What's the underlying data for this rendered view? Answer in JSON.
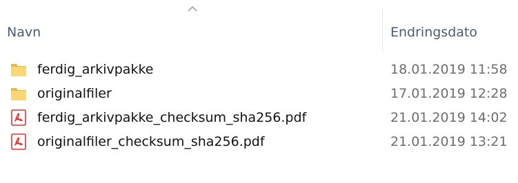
{
  "header": {
    "name_label": "Navn",
    "date_label": "Endringsdato",
    "sort_icon": "chevron-up-icon"
  },
  "files": [
    {
      "name": "ferdig_arkivpakke",
      "modified": "18.01.2019 11:58",
      "type": "folder",
      "icon": "folder-icon"
    },
    {
      "name": "originalfiler",
      "modified": "17.01.2019 12:28",
      "type": "folder",
      "icon": "folder-icon"
    },
    {
      "name": "ferdig_arkivpakke_checksum_sha256.pdf",
      "modified": "21.01.2019 14:02",
      "type": "pdf",
      "icon": "pdf-file-icon"
    },
    {
      "name": "originalfiler_checksum_sha256.pdf",
      "modified": "21.01.2019 13:21",
      "type": "pdf",
      "icon": "pdf-file-icon"
    }
  ],
  "colors": {
    "header_text": "#4a5a78",
    "folder_yellow": "#f8d775",
    "pdf_red": "#d9332b",
    "date_text": "#6d6d6d"
  }
}
